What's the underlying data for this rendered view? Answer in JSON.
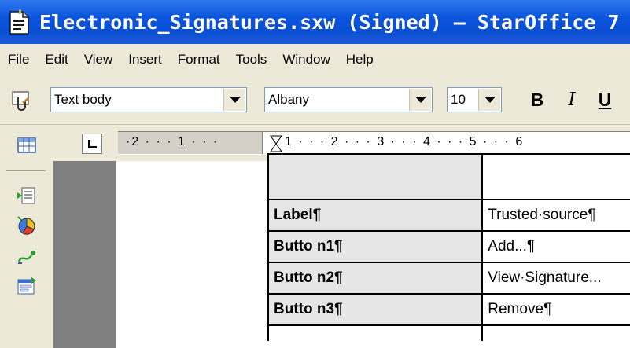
{
  "window": {
    "title": "Electronic_Signatures.sxw (Signed) – StarOffice 7"
  },
  "menu": [
    "File",
    "Edit",
    "View",
    "Insert",
    "Format",
    "Tools",
    "Window",
    "Help"
  ],
  "toolbar": {
    "paragraph_style": "Text body",
    "font_name": "Albany",
    "font_size": "10",
    "bold_label": "B",
    "italic_label": "I",
    "underline_label": "U"
  },
  "ruler": {
    "left_text": "·2 · · · 1 · · ·",
    "right_text": "1 · · · 2 · · · 3 · · · 4 · · · 5 · · · 6"
  },
  "table": {
    "rows": [
      {
        "label": "Label¶",
        "value": "Trusted·source¶"
      },
      {
        "label": "Butto n1¶",
        "value": "Add...¶"
      },
      {
        "label": "Butto n2¶",
        "value": "View·Signature..."
      },
      {
        "label": "Butto n3¶",
        "value": "Remove¶"
      }
    ]
  },
  "icons": {
    "app": "staroffice-document-icon",
    "stylist": "stylist-icon",
    "navigator": "table-icon",
    "insert": "insert-icon",
    "chart": "chart-icon",
    "draw": "draw-functions-icon",
    "form": "form-icon"
  },
  "colors": {
    "titlebar": "#0a55dd",
    "chrome": "#ece9d8",
    "doc_background": "#808080",
    "table_shade": "#e6e6e6"
  }
}
